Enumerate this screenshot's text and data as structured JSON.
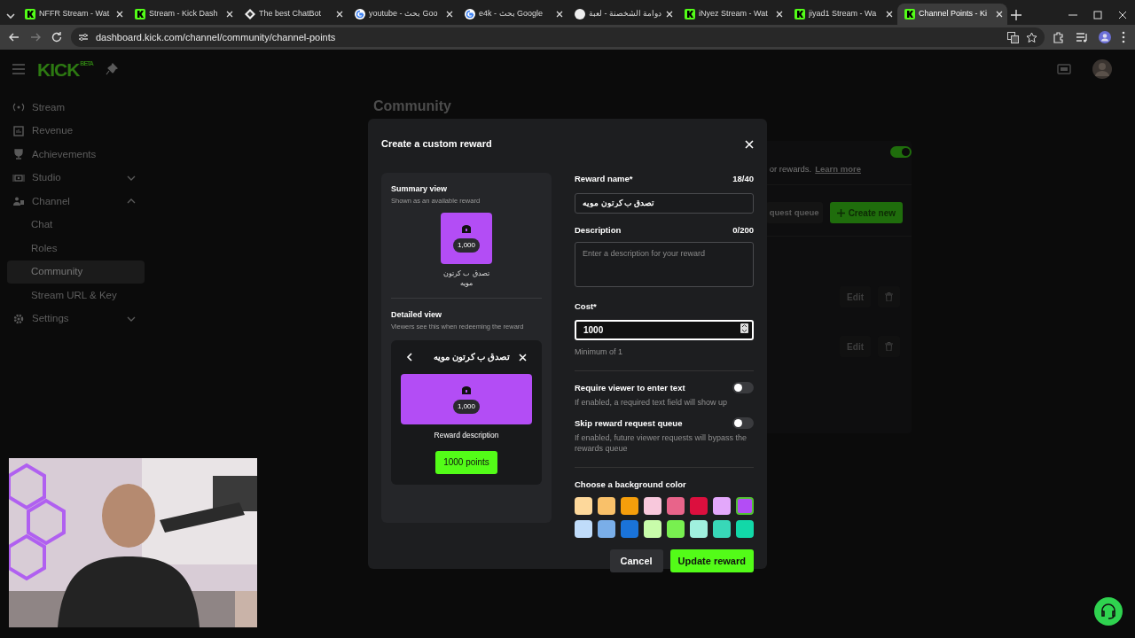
{
  "browser": {
    "tabs": [
      {
        "title": "NFFR Stream - Wat",
        "kind": "kick",
        "selected": false
      },
      {
        "title": "Stream - Kick Dash",
        "kind": "kick",
        "selected": false
      },
      {
        "title": "The best ChatBot",
        "kind": "diamond",
        "selected": false
      },
      {
        "title": "youtube - بحث Goo",
        "kind": "google",
        "selected": false
      },
      {
        "title": "e4k - بحث Google",
        "kind": "google",
        "selected": false
      },
      {
        "title": "دوامة الشخصنة - لعبة",
        "kind": "blank",
        "selected": false
      },
      {
        "title": "iNyez Stream - Wat",
        "kind": "kick",
        "selected": false
      },
      {
        "title": "jiyad1 Stream - Wa",
        "kind": "kick",
        "selected": false
      },
      {
        "title": "Channel Points - Ki",
        "kind": "kick",
        "selected": true
      }
    ],
    "url": "dashboard.kick.com/channel/community/channel-points"
  },
  "header": {
    "logo": "KICK",
    "logo_badge": "BETA"
  },
  "sidebar": {
    "items": [
      {
        "label": "Stream",
        "selected": false
      },
      {
        "label": "Revenue",
        "selected": false
      },
      {
        "label": "Achievements",
        "selected": false
      },
      {
        "label": "Studio",
        "selected": false,
        "expanded": false
      },
      {
        "label": "Channel",
        "selected": false,
        "expanded": true,
        "children": [
          {
            "label": "Chat",
            "selected": false
          },
          {
            "label": "Roles",
            "selected": false
          },
          {
            "label": "Community",
            "selected": true
          },
          {
            "label": "Stream URL & Key",
            "selected": false
          }
        ]
      },
      {
        "label": "Settings",
        "selected": false,
        "expanded": false
      }
    ]
  },
  "page": {
    "title": "Community",
    "enabled": true,
    "info_text": "or rewards.",
    "info_link": "Learn more",
    "queue_button": "quest queue",
    "create_button": "Create new",
    "rewards": [
      {
        "edit": "Edit"
      },
      {
        "edit": "Edit"
      }
    ]
  },
  "modal": {
    "title": "Create a custom reward",
    "summary": {
      "title": "Summary view",
      "subtitle": "Shown as an available reward",
      "cost": "1,000",
      "name": "تصدق ب كرتون مويه"
    },
    "detailed": {
      "title": "Detailed view",
      "subtitle": "Viewers see this when redeeming the reward",
      "name": "تصدق ب كرتون مويه",
      "cost": "1,000",
      "description": "Reward description",
      "points_button": "1000 points"
    },
    "form": {
      "name_label": "Reward name*",
      "name_count": "18/40",
      "name_value": "تصدق ب كرتون مويه",
      "description_label": "Description",
      "description_count": "0/200",
      "description_placeholder": "Enter a description for your reward",
      "cost_label": "Cost*",
      "cost_value": "1000",
      "cost_hint": "Minimum of 1",
      "toggles": [
        {
          "label": "Require viewer to enter text",
          "help": "If enabled, a required text field will show up",
          "on": false
        },
        {
          "label": "Skip reward request queue",
          "help": "If enabled, future viewer requests will bypass the rewards queue",
          "on": false
        }
      ],
      "color_label": "Choose a background color",
      "colors": [
        {
          "color": "#fdd89b",
          "selected": false
        },
        {
          "color": "#f9c16a",
          "selected": false
        },
        {
          "color": "#f59e0b",
          "selected": false
        },
        {
          "color": "#f8c8dc",
          "selected": false
        },
        {
          "color": "#e8648a",
          "selected": false
        },
        {
          "color": "#dc0f3e",
          "selected": false
        },
        {
          "color": "#e3a8fb",
          "selected": false
        },
        {
          "color": "#b34df5",
          "selected": true
        },
        {
          "color": "#c0dcfa",
          "selected": false
        },
        {
          "color": "#7aaee8",
          "selected": false
        },
        {
          "color": "#1a73d9",
          "selected": false
        },
        {
          "color": "#c8fcaa",
          "selected": false
        },
        {
          "color": "#78f050",
          "selected": false
        },
        {
          "color": "#a0f0de",
          "selected": false
        },
        {
          "color": "#38d8b8",
          "selected": false
        },
        {
          "color": "#12d8a8",
          "selected": false
        }
      ]
    },
    "cancel_button": "Cancel",
    "submit_button": "Update reward"
  }
}
